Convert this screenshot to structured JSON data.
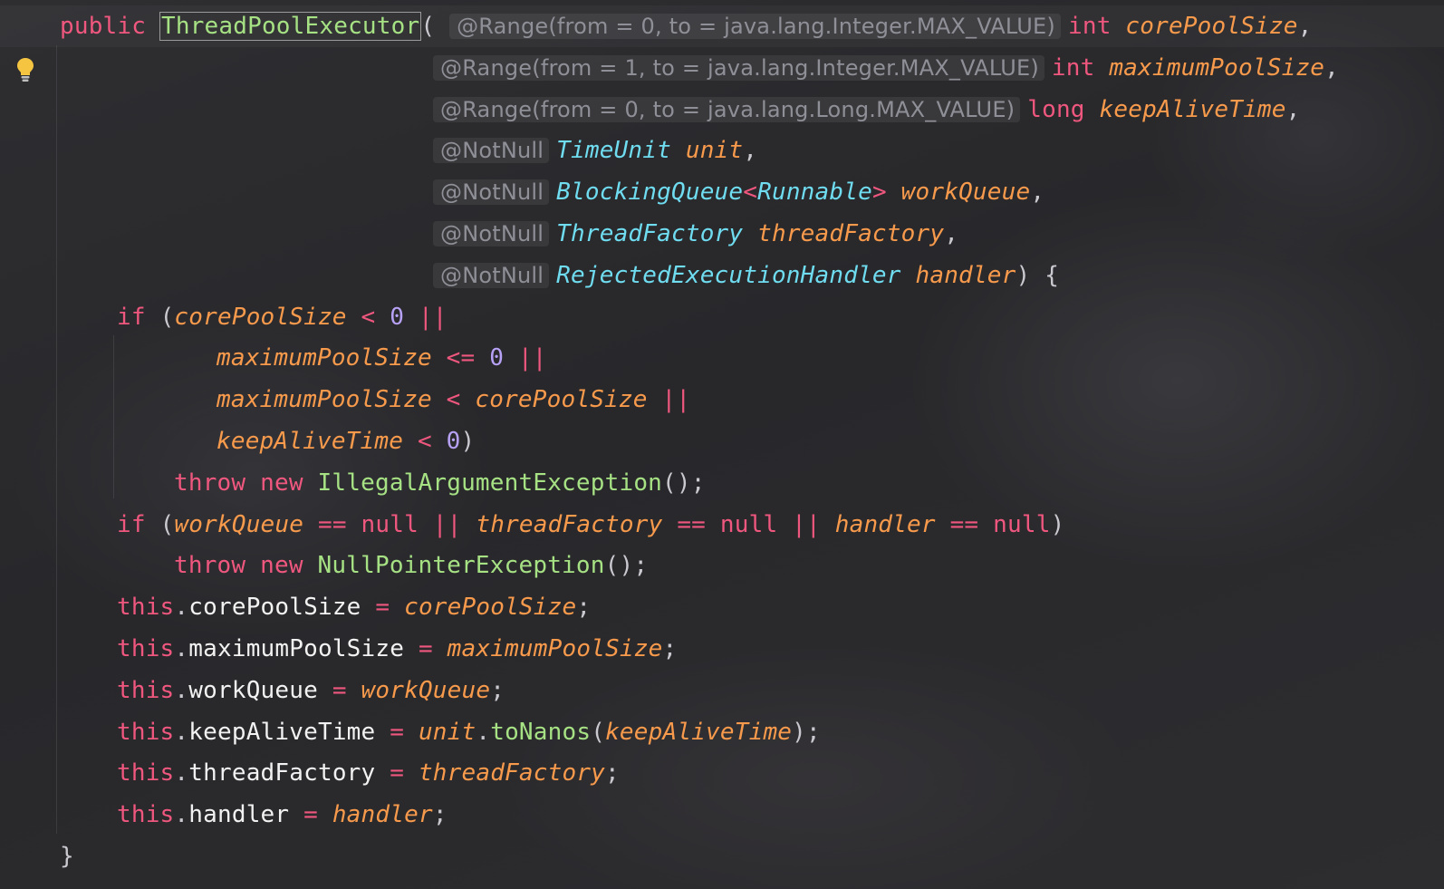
{
  "colors": {
    "keyword": "#f0577f",
    "function": "#a6e184",
    "class": "#6fdcf0",
    "parameter": "#f89a4c",
    "number": "#b7a1f5",
    "field": "#f2f2f2",
    "annotation": "#8f8f98",
    "background": "#2b2b2e"
  },
  "gutter": {
    "icon": "lightbulb-icon"
  },
  "lines": [
    {
      "indent": 66,
      "segs": [
        {
          "t": "public ",
          "c": "kw"
        },
        {
          "t": "ThreadPoolExecutor",
          "c": "fn",
          "boxed": true
        },
        {
          "t": "( ",
          "c": "pun"
        },
        {
          "t": "@Range(from = 0, to = java.lang.Integer.MAX_VALUE)",
          "c": "ann"
        },
        {
          "t": "int ",
          "c": "kw"
        },
        {
          "t": "corePoolSize",
          "c": "prm"
        },
        {
          "t": ",",
          "c": "pun"
        }
      ]
    },
    {
      "indent": 478,
      "segs": [
        {
          "t": "@Range(from = 1, to = java.lang.Integer.MAX_VALUE)",
          "c": "ann"
        },
        {
          "t": "int ",
          "c": "kw"
        },
        {
          "t": "maximumPoolSize",
          "c": "prm"
        },
        {
          "t": ",",
          "c": "pun"
        }
      ]
    },
    {
      "indent": 478,
      "segs": [
        {
          "t": "@Range(from = 0, to = java.lang.Long.MAX_VALUE)",
          "c": "ann"
        },
        {
          "t": "long ",
          "c": "kw"
        },
        {
          "t": "keepAliveTime",
          "c": "prm"
        },
        {
          "t": ",",
          "c": "pun"
        }
      ]
    },
    {
      "indent": 478,
      "segs": [
        {
          "t": "@NotNull",
          "c": "ann"
        },
        {
          "t": "TimeUnit ",
          "c": "cls"
        },
        {
          "t": "unit",
          "c": "prm"
        },
        {
          "t": ",",
          "c": "pun"
        }
      ]
    },
    {
      "indent": 478,
      "segs": [
        {
          "t": "@NotNull",
          "c": "ann"
        },
        {
          "t": "BlockingQueue",
          "c": "cls"
        },
        {
          "t": "<",
          "c": "gen"
        },
        {
          "t": "Runnable",
          "c": "cls"
        },
        {
          "t": "> ",
          "c": "gen"
        },
        {
          "t": "workQueue",
          "c": "prm"
        },
        {
          "t": ",",
          "c": "pun"
        }
      ]
    },
    {
      "indent": 478,
      "segs": [
        {
          "t": "@NotNull",
          "c": "ann"
        },
        {
          "t": "ThreadFactory ",
          "c": "cls"
        },
        {
          "t": "threadFactory",
          "c": "prm"
        },
        {
          "t": ",",
          "c": "pun"
        }
      ]
    },
    {
      "indent": 478,
      "segs": [
        {
          "t": "@NotNull",
          "c": "ann"
        },
        {
          "t": "RejectedExecutionHandler ",
          "c": "cls"
        },
        {
          "t": "handler",
          "c": "prm"
        },
        {
          "t": ") {",
          "c": "pun"
        }
      ]
    },
    {
      "indent": 129,
      "segs": [
        {
          "t": "if ",
          "c": "kw"
        },
        {
          "t": "(",
          "c": "pun"
        },
        {
          "t": "corePoolSize",
          "c": "prm"
        },
        {
          "t": " < ",
          "c": "op"
        },
        {
          "t": "0",
          "c": "num"
        },
        {
          "t": " ||",
          "c": "op"
        }
      ]
    },
    {
      "indent": 239,
      "segs": [
        {
          "t": "maximumPoolSize",
          "c": "prm"
        },
        {
          "t": " <= ",
          "c": "op"
        },
        {
          "t": "0",
          "c": "num"
        },
        {
          "t": " ||",
          "c": "op"
        }
      ]
    },
    {
      "indent": 239,
      "segs": [
        {
          "t": "maximumPoolSize",
          "c": "prm"
        },
        {
          "t": " < ",
          "c": "op"
        },
        {
          "t": "corePoolSize",
          "c": "prm"
        },
        {
          "t": " ||",
          "c": "op"
        }
      ]
    },
    {
      "indent": 239,
      "segs": [
        {
          "t": "keepAliveTime",
          "c": "prm"
        },
        {
          "t": " < ",
          "c": "op"
        },
        {
          "t": "0",
          "c": "num"
        },
        {
          "t": ")",
          "c": "pun"
        }
      ]
    },
    {
      "indent": 192,
      "segs": [
        {
          "t": "throw new ",
          "c": "kw"
        },
        {
          "t": "IllegalArgumentException",
          "c": "fn"
        },
        {
          "t": "();",
          "c": "pun"
        }
      ]
    },
    {
      "indent": 129,
      "segs": [
        {
          "t": "if ",
          "c": "kw"
        },
        {
          "t": "(",
          "c": "pun"
        },
        {
          "t": "workQueue",
          "c": "prm"
        },
        {
          "t": " == ",
          "c": "op"
        },
        {
          "t": "null",
          "c": "kw"
        },
        {
          "t": " || ",
          "c": "op"
        },
        {
          "t": "threadFactory",
          "c": "prm"
        },
        {
          "t": " == ",
          "c": "op"
        },
        {
          "t": "null",
          "c": "kw"
        },
        {
          "t": " || ",
          "c": "op"
        },
        {
          "t": "handler",
          "c": "prm"
        },
        {
          "t": " == ",
          "c": "op"
        },
        {
          "t": "null",
          "c": "kw"
        },
        {
          "t": ")",
          "c": "pun"
        }
      ]
    },
    {
      "indent": 192,
      "segs": [
        {
          "t": "throw new ",
          "c": "kw"
        },
        {
          "t": "NullPointerException",
          "c": "fn"
        },
        {
          "t": "();",
          "c": "pun"
        }
      ]
    },
    {
      "indent": 129,
      "segs": [
        {
          "t": "this",
          "c": "kw"
        },
        {
          "t": ".",
          "c": "pun"
        },
        {
          "t": "corePoolSize",
          "c": "fld"
        },
        {
          "t": " = ",
          "c": "op"
        },
        {
          "t": "corePoolSize",
          "c": "prm"
        },
        {
          "t": ";",
          "c": "pun"
        }
      ]
    },
    {
      "indent": 129,
      "segs": [
        {
          "t": "this",
          "c": "kw"
        },
        {
          "t": ".",
          "c": "pun"
        },
        {
          "t": "maximumPoolSize",
          "c": "fld"
        },
        {
          "t": " = ",
          "c": "op"
        },
        {
          "t": "maximumPoolSize",
          "c": "prm"
        },
        {
          "t": ";",
          "c": "pun"
        }
      ]
    },
    {
      "indent": 129,
      "segs": [
        {
          "t": "this",
          "c": "kw"
        },
        {
          "t": ".",
          "c": "pun"
        },
        {
          "t": "workQueue",
          "c": "fld"
        },
        {
          "t": " = ",
          "c": "op"
        },
        {
          "t": "workQueue",
          "c": "prm"
        },
        {
          "t": ";",
          "c": "pun"
        }
      ]
    },
    {
      "indent": 129,
      "segs": [
        {
          "t": "this",
          "c": "kw"
        },
        {
          "t": ".",
          "c": "pun"
        },
        {
          "t": "keepAliveTime",
          "c": "fld"
        },
        {
          "t": " = ",
          "c": "op"
        },
        {
          "t": "unit",
          "c": "prm"
        },
        {
          "t": ".",
          "c": "pun"
        },
        {
          "t": "toNanos",
          "c": "fn"
        },
        {
          "t": "(",
          "c": "pun"
        },
        {
          "t": "keepAliveTime",
          "c": "prm"
        },
        {
          "t": ");",
          "c": "pun"
        }
      ]
    },
    {
      "indent": 129,
      "segs": [
        {
          "t": "this",
          "c": "kw"
        },
        {
          "t": ".",
          "c": "pun"
        },
        {
          "t": "threadFactory",
          "c": "fld"
        },
        {
          "t": " = ",
          "c": "op"
        },
        {
          "t": "threadFactory",
          "c": "prm"
        },
        {
          "t": ";",
          "c": "pun"
        }
      ]
    },
    {
      "indent": 129,
      "segs": [
        {
          "t": "this",
          "c": "kw"
        },
        {
          "t": ".",
          "c": "pun"
        },
        {
          "t": "handler",
          "c": "fld"
        },
        {
          "t": " = ",
          "c": "op"
        },
        {
          "t": "handler",
          "c": "prm"
        },
        {
          "t": ";",
          "c": "pun"
        }
      ]
    },
    {
      "indent": 66,
      "segs": [
        {
          "t": "}",
          "c": "pun"
        }
      ]
    }
  ]
}
